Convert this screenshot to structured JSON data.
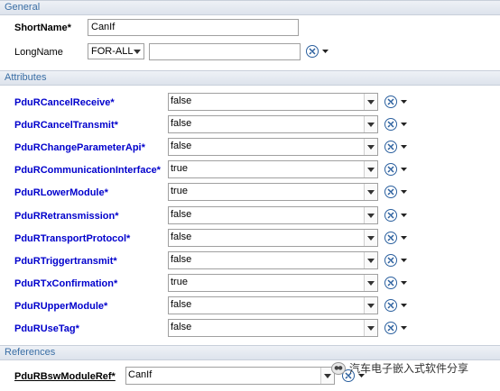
{
  "general": {
    "header": "General",
    "short_name_label": "ShortName*",
    "short_name_value": "CanIf",
    "long_name_label": "LongName",
    "language_value": "FOR-ALL",
    "long_name_value": ""
  },
  "attributes": {
    "header": "Attributes",
    "items": [
      {
        "label": "PduRCancelReceive*",
        "value": "false"
      },
      {
        "label": "PduRCancelTransmit*",
        "value": "false"
      },
      {
        "label": "PduRChangeParameterApi*",
        "value": "false"
      },
      {
        "label": "PduRCommunicationInterface*",
        "value": "true"
      },
      {
        "label": "PduRLowerModule*",
        "value": "true"
      },
      {
        "label": "PduRRetransmission*",
        "value": "false"
      },
      {
        "label": "PduRTransportProtocol*",
        "value": "false"
      },
      {
        "label": "PduRTriggertransmit*",
        "value": "false"
      },
      {
        "label": "PduRTxConfirmation*",
        "value": "true"
      },
      {
        "label": "PduRUpperModule*",
        "value": "false"
      },
      {
        "label": "PduRUseTag*",
        "value": "false"
      }
    ]
  },
  "references": {
    "header": "References",
    "items": [
      {
        "label": "PduRBswModuleRef*",
        "value": "CanIf"
      }
    ]
  },
  "watermark": {
    "text": "汽车电子嵌入式软件分享"
  },
  "colors": {
    "label_blue": "#0000cc",
    "header_text": "#3a6ea5",
    "icon_blue": "#2a5f9e"
  }
}
